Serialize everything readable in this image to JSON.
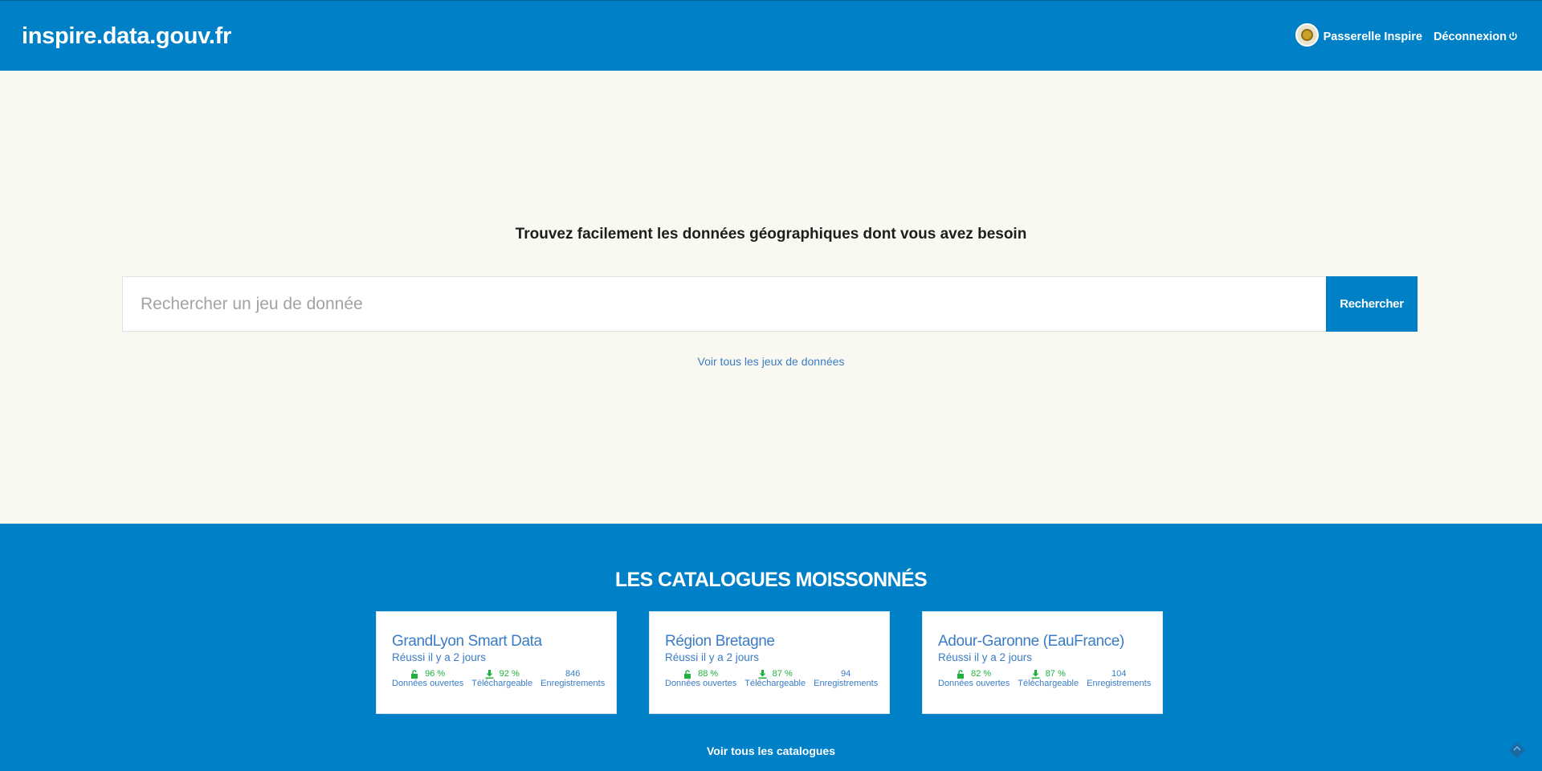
{
  "header": {
    "brand": "inspire.data.gouv.fr",
    "user_name": "Passerelle Inspire",
    "logout_label": "Déconnexion"
  },
  "hero": {
    "title": "Trouvez facilement les données géographiques dont vous avez besoin",
    "search_placeholder": "Rechercher un jeu de donnée",
    "search_value": "",
    "search_button": "Rechercher",
    "all_datasets_link": "Voir tous les jeux de données"
  },
  "catalogs": {
    "title": "LES CATALOGUES MOISSONNÉS",
    "all_catalogs_link": "Voir tous les catalogues",
    "items": [
      {
        "name": "GrandLyon Smart Data",
        "status": "Réussi il y a 2 jours",
        "open_data_value": "96 %",
        "open_data_label": "Données ouvertes",
        "downloadable_value": "92 %",
        "downloadable_label": "Téléchargeable",
        "records_value": "846",
        "records_label": "Enregistrements"
      },
      {
        "name": "Région Bretagne",
        "status": "Réussi il y a 2 jours",
        "open_data_value": "88 %",
        "open_data_label": "Données ouvertes",
        "downloadable_value": "87 %",
        "downloadable_label": "Téléchargeable",
        "records_value": "94",
        "records_label": "Enregistrements"
      },
      {
        "name": "Adour-Garonne (EauFrance)",
        "status": "Réussi il y a 2 jours",
        "open_data_value": "82 %",
        "open_data_label": "Données ouvertes",
        "downloadable_value": "87 %",
        "downloadable_label": "Téléchargeable",
        "records_value": "104",
        "records_label": "Enregistrements"
      }
    ]
  },
  "icons": {
    "avatar": "avatar-icon",
    "logout": "power-icon",
    "open_data": "unlock-icon",
    "downloadable": "download-icon",
    "corner": "diamond-widget-icon"
  },
  "colors": {
    "primary": "#0081c7",
    "hero_background": "#f9f9f1",
    "link": "#3a7cc5",
    "success": "#20b13d"
  }
}
